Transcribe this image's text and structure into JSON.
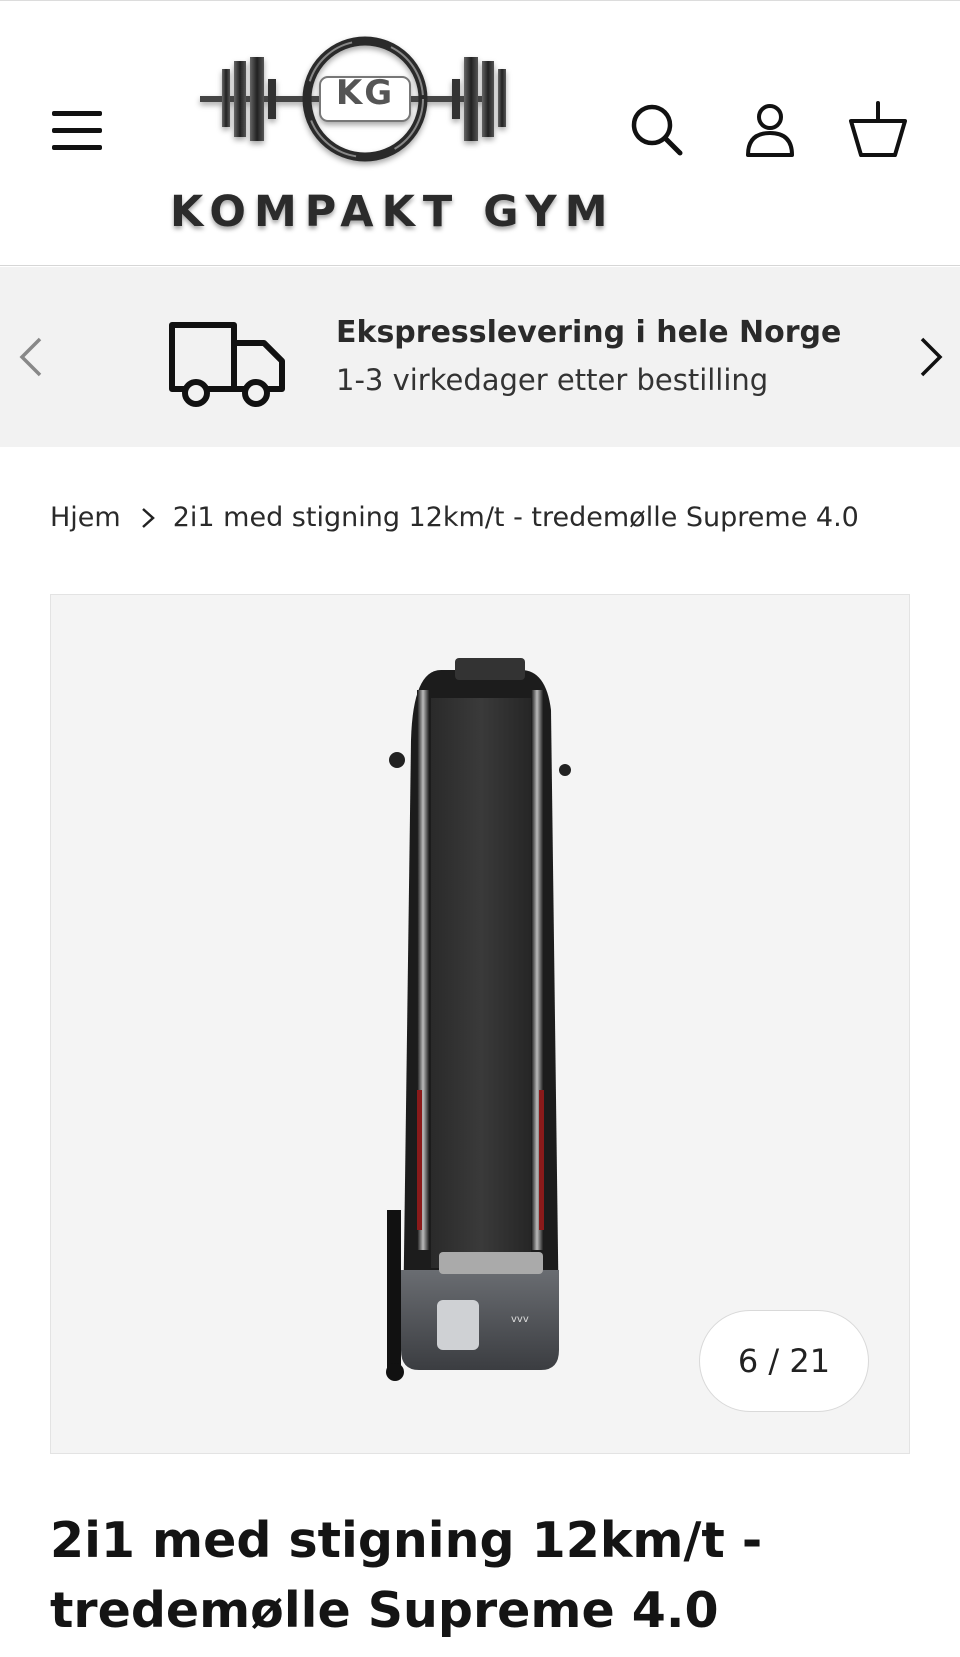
{
  "header": {
    "menu_icon": "hamburger-menu-icon",
    "logo": {
      "monogram": "KG",
      "name": "KOMPAKT GYM"
    },
    "search_icon": "search-icon",
    "account_icon": "account-icon",
    "cart_icon": "basket-icon"
  },
  "promo": {
    "icon": "delivery-truck-icon",
    "title": "Ekspresslevering i hele Norge",
    "subtitle": "1-3 virkedager etter bestilling",
    "prev_icon": "chevron-left-icon",
    "next_icon": "chevron-right-icon"
  },
  "breadcrumb": {
    "home": "Hjem",
    "separator_icon": "chevron-right-icon",
    "current": "2i1 med stigning 12km/t - tredemølle Supreme 4.0"
  },
  "gallery": {
    "counter": "6 / 21"
  },
  "product": {
    "title": "2i1 med stigning 12km/t - tredemølle Supreme 4.0"
  },
  "colors": {
    "text": "#141414",
    "promo_bg": "#f2f2f2",
    "gallery_bg": "#f4f4f4"
  }
}
